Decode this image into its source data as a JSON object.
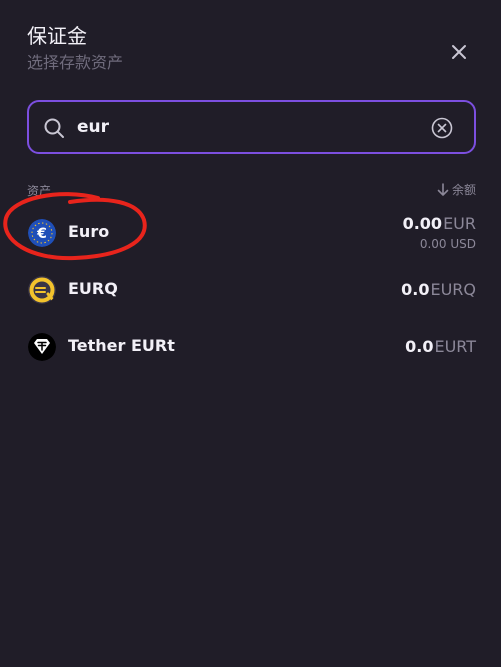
{
  "modal": {
    "title": "保证金",
    "subtitle": "选择存款资产"
  },
  "search": {
    "value": "eur",
    "placeholder": ""
  },
  "columns": {
    "asset": "资产",
    "balance": "余额"
  },
  "assets": [
    {
      "name": "Euro",
      "amount": "0.00",
      "currency": "EUR",
      "sub": "0.00 USD",
      "icon": "euro-coin-icon",
      "color": "#1f4fb8"
    },
    {
      "name": "EURQ",
      "amount": "0.0",
      "currency": "EURQ",
      "icon": "eurq-coin-icon",
      "color": "#f3c32c"
    },
    {
      "name": "Tether EURt",
      "amount": "0.0",
      "currency": "EURT",
      "icon": "tether-coin-icon",
      "color": "#ffffff"
    }
  ],
  "theme": {
    "accent": "#7c4fe0",
    "annotation": "#e8241c"
  }
}
